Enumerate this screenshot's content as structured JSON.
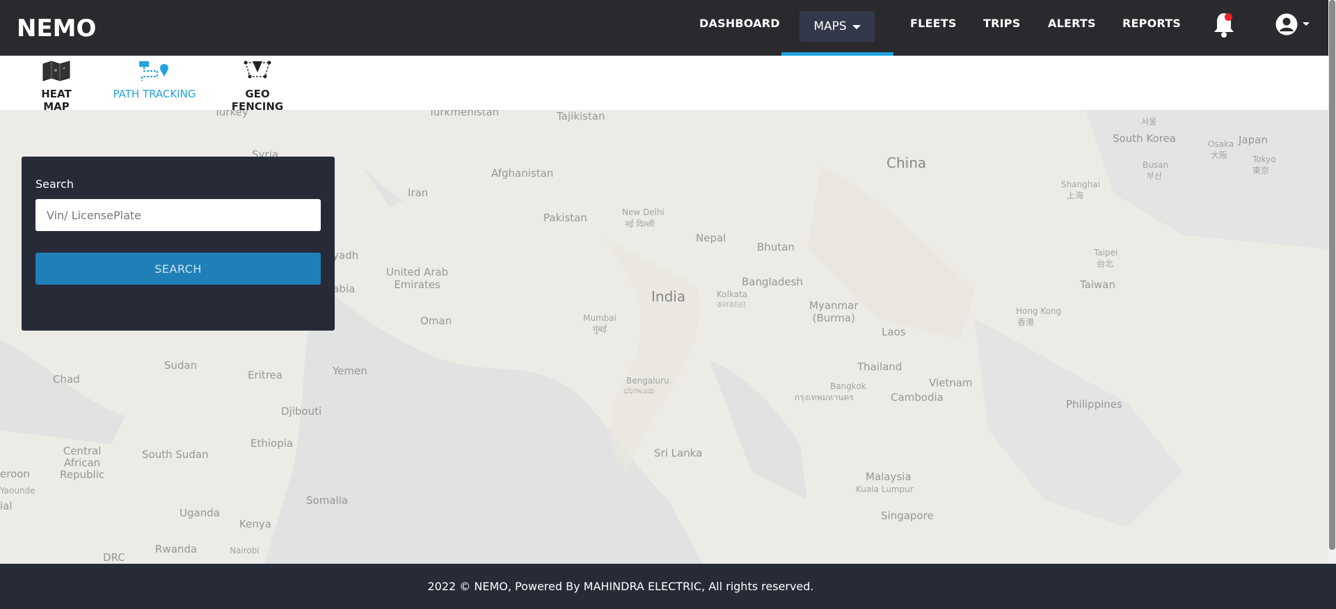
{
  "brand": {
    "logo_text": "NEMO"
  },
  "nav": {
    "dashboard": "DASHBOARD",
    "maps": "MAPS",
    "fleets": "FLEETS",
    "trips": "TRIPS",
    "alerts": "ALERTS",
    "reports": "REPORTS"
  },
  "subnav": {
    "heat_map": "HEAT MAP",
    "path_tracking": "PATH TRACKING",
    "geo_fencing": "GEO FENCING"
  },
  "search": {
    "title": "Search",
    "placeholder": "Vin/ LicensePlate",
    "button": "SEARCH"
  },
  "map_labels": {
    "turkmenistan": "Turkmenistan",
    "tajikistan": "Tajikistan",
    "turkey": "Turkey",
    "syria": "Syria",
    "afghanistan": "Afghanistan",
    "iran": "Iran",
    "pakistan": "Pakistan",
    "new_delhi": "New Delhi",
    "new_delhi_local": "नई दिल्ली",
    "nepal": "Nepal",
    "bhutan": "Bhutan",
    "china": "China",
    "south_korea": "South Korea",
    "japan": "Japan",
    "osaka": "Osaka",
    "osaka_local": "大阪",
    "tokyo": "Tokyo",
    "tokyo_local": "東京",
    "busan": "Busan",
    "busan_local": "부산",
    "shanghai": "Shanghai",
    "shanghai_local": "上海",
    "seoul_local": "서울",
    "riyadh": "yadh",
    "uae": "United Arab\nEmirates",
    "arabia": "rabia",
    "india": "India",
    "bangladesh": "Bangladesh",
    "kolkata": "Kolkata",
    "kolkata_local": "কলকাতা",
    "taipei": "Taipei",
    "taipei_local": "台北",
    "taiwan": "Taiwan",
    "myanmar": "Myanmar\n(Burma)",
    "oman": "Oman",
    "mumbai": "Mumbai",
    "mumbai_local": "मुंबई",
    "laos": "Laos",
    "hong_kong": "Hong Kong",
    "hong_kong_local": "香港",
    "chad": "Chad",
    "sudan": "Sudan",
    "eritrea": "Eritrea",
    "yemen": "Yemen",
    "thailand": "Thailand",
    "bangkok": "Bangkok",
    "bangkok_local": "กรุงเทพมหานคร",
    "vietnam": "Vietnam",
    "bengaluru": "Bengaluru",
    "bengaluru_local": "ಬೆಂಗಳೂರು",
    "djibouti": "Djibouti",
    "cambodia": "Cambodia",
    "philippines": "Philippines",
    "central_african_republic": "Central\nAfrican\nRepublic",
    "south_sudan": "South Sudan",
    "ethiopia": "Ethiopia",
    "sri_lanka": "Sri Lanka",
    "cameroon": "eroon",
    "yaounde": "Yaounde",
    "malaysia": "Malaysia",
    "kuala_lumpur": "Kuala Lumpur",
    "somalia": "Somalia",
    "uganda": "Uganda",
    "kenya": "Kenya",
    "singapore": "Singapore",
    "rwanda": "Rwanda",
    "nairobi": "Nairobi",
    "drc": "DRC",
    "ial": "ial"
  },
  "footer": {
    "text": "2022 © NEMO, Powered By MAHINDRA ELECTRIC, All rights reserved."
  },
  "colors": {
    "accent": "#1fa3e0",
    "navbar": "#2a2a2e",
    "panel": "#272b38",
    "button": "#1f80b7",
    "notification": "#e8202a"
  }
}
